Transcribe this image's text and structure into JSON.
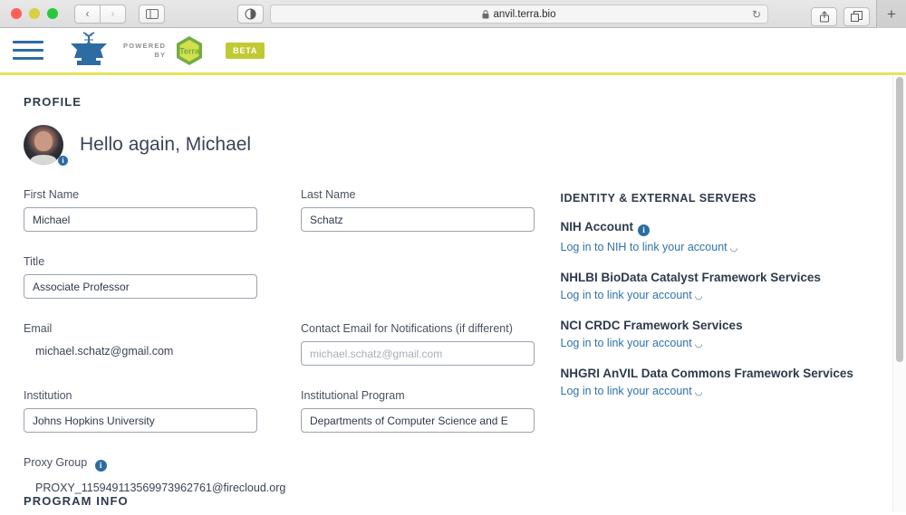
{
  "browser": {
    "url": "anvil.terra.bio",
    "lock_icon": "lock-icon",
    "reload_icon": "reload-icon",
    "back_icon": "‹",
    "forward_icon": "›",
    "sidebar_icon": "sidebar-icon",
    "reader_icon": "reader-view-icon",
    "share_icon": "share-icon",
    "tabs_icon": "tab-overview-icon",
    "newtab_label": "+"
  },
  "header": {
    "menu_icon": "hamburger-menu-icon",
    "logo_name": "anvil-logo",
    "powered_by_line1": "POWERED",
    "powered_by_line2": "BY",
    "terra_badge": "Terra",
    "beta_badge": "BETA",
    "accent_color": "#e7e457"
  },
  "profile": {
    "section_title": "PROFILE",
    "greeting": "Hello again, Michael",
    "avatar_name": "user-avatar",
    "avatar_badge": "i"
  },
  "form": {
    "first_name": {
      "label": "First Name",
      "value": "Michael"
    },
    "last_name": {
      "label": "Last Name",
      "value": "Schatz"
    },
    "title": {
      "label": "Title",
      "value": "Associate Professor"
    },
    "email": {
      "label": "Email",
      "value": "michael.schatz@gmail.com"
    },
    "contact_email": {
      "label": "Contact Email for Notifications (if different)",
      "value": "",
      "placeholder": "michael.schatz@gmail.com"
    },
    "institution": {
      "label": "Institution",
      "value": "Johns Hopkins University"
    },
    "institutional_program": {
      "label": "Institutional Program",
      "value": "Departments of Computer Science and E"
    },
    "proxy_group": {
      "label": "Proxy Group",
      "info_icon": "i",
      "value": "PROXY_115949113569973962761@firecloud.org"
    }
  },
  "identity": {
    "title": "IDENTITY & EXTERNAL SERVERS",
    "servers": [
      {
        "name": "NIH Account",
        "has_info": true,
        "info_icon": "i",
        "link": "Log in to NIH to link your account"
      },
      {
        "name": "NHLBI BioData Catalyst Framework Services",
        "has_info": false,
        "link": "Log in to link your account"
      },
      {
        "name": "NCI CRDC Framework Services",
        "has_info": false,
        "link": "Log in to link your account"
      },
      {
        "name": "NHGRI AnVIL Data Commons Framework Services",
        "has_info": false,
        "link": "Log in to link your account"
      }
    ],
    "external_link_icon": "↗"
  },
  "footer": {
    "program_info_title": "PROGRAM INFO"
  }
}
